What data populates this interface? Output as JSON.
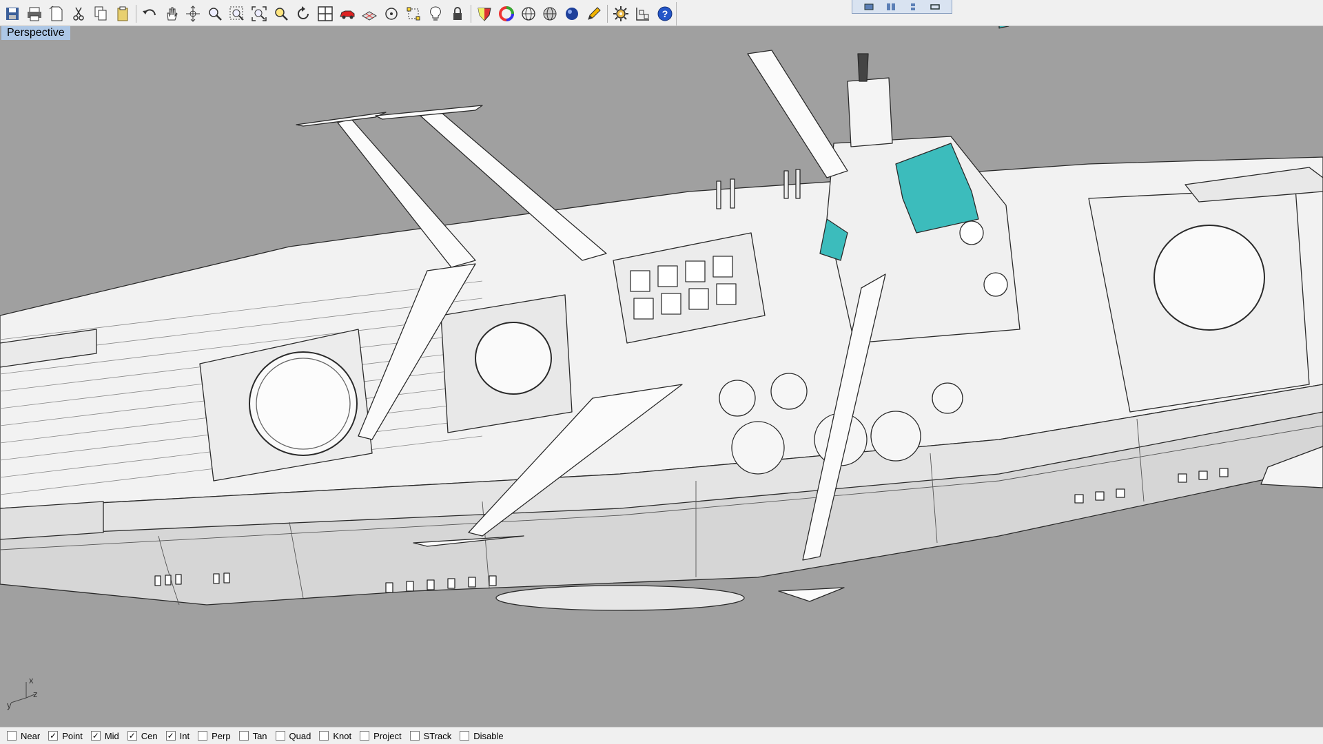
{
  "viewport": {
    "label": "Perspective",
    "axes": {
      "x": "x",
      "y": "y",
      "z": "z"
    }
  },
  "toolbar": {
    "items": [
      {
        "name": "save-icon"
      },
      {
        "name": "print-icon"
      },
      {
        "name": "new-page-icon"
      },
      {
        "name": "cut-icon"
      },
      {
        "name": "copy-icon"
      },
      {
        "name": "paste-icon"
      },
      {
        "name": "undo-icon"
      },
      {
        "name": "pan-hand-icon"
      },
      {
        "name": "rotate-view-icon"
      },
      {
        "name": "zoom-icon"
      },
      {
        "name": "zoom-window-icon"
      },
      {
        "name": "zoom-extents-icon"
      },
      {
        "name": "zoom-selected-icon"
      },
      {
        "name": "undo-view-icon"
      },
      {
        "name": "four-viewports-icon"
      },
      {
        "name": "car-icon"
      },
      {
        "name": "grid-plane-icon"
      },
      {
        "name": "circle-point-icon"
      },
      {
        "name": "select-points-icon"
      },
      {
        "name": "lightbulb-icon"
      },
      {
        "name": "lock-icon"
      },
      {
        "name": "material-shield-icon"
      },
      {
        "name": "color-wheel-icon"
      },
      {
        "name": "wireframe-sphere-icon"
      },
      {
        "name": "shaded-sphere-icon"
      },
      {
        "name": "render-sphere-icon"
      },
      {
        "name": "pencil-icon"
      },
      {
        "name": "settings-gear-icon"
      },
      {
        "name": "cplane-icon"
      },
      {
        "name": "help-icon"
      }
    ]
  },
  "osnap": [
    {
      "label": "Near",
      "checked": false
    },
    {
      "label": "Point",
      "checked": true
    },
    {
      "label": "Mid",
      "checked": true
    },
    {
      "label": "Cen",
      "checked": true
    },
    {
      "label": "Int",
      "checked": true
    },
    {
      "label": "Perp",
      "checked": false
    },
    {
      "label": "Tan",
      "checked": false
    },
    {
      "label": "Quad",
      "checked": false
    },
    {
      "label": "Knot",
      "checked": false
    },
    {
      "label": "Project",
      "checked": false
    },
    {
      "label": "STrack",
      "checked": false
    },
    {
      "label": "Disable",
      "checked": false
    }
  ],
  "colors": {
    "viewport_bg": "#a0a0a0",
    "model_fill": "#f4f4f4",
    "model_line": "#2a2a2a",
    "accent_teal": "#3cbcbc",
    "label_bg": "#adc7e6"
  }
}
